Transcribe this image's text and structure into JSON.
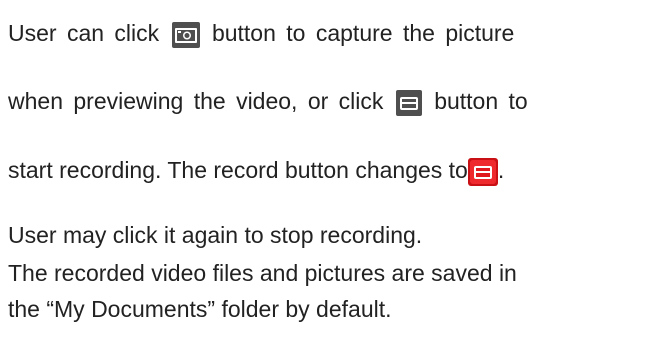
{
  "paragraph": {
    "line1_a": "User can click",
    "line1_b": "button to capture the picture",
    "line2_a": "when previewing the video, or click",
    "line2_b": "button to",
    "line3_a": "start recording. The record button changes to",
    "line3_b": ".",
    "line4": "User may click it again to stop recording.",
    "line5": "The recorded video files and pictures are saved in",
    "line6": "the “My Documents” folder by default."
  },
  "icons": {
    "capture": "camera-capture-icon",
    "record": "record-icon",
    "recording": "recording-active-icon"
  },
  "colors": {
    "text": "#222222",
    "icon_dark": "#4a4a4a",
    "icon_red": "#e0191e"
  }
}
